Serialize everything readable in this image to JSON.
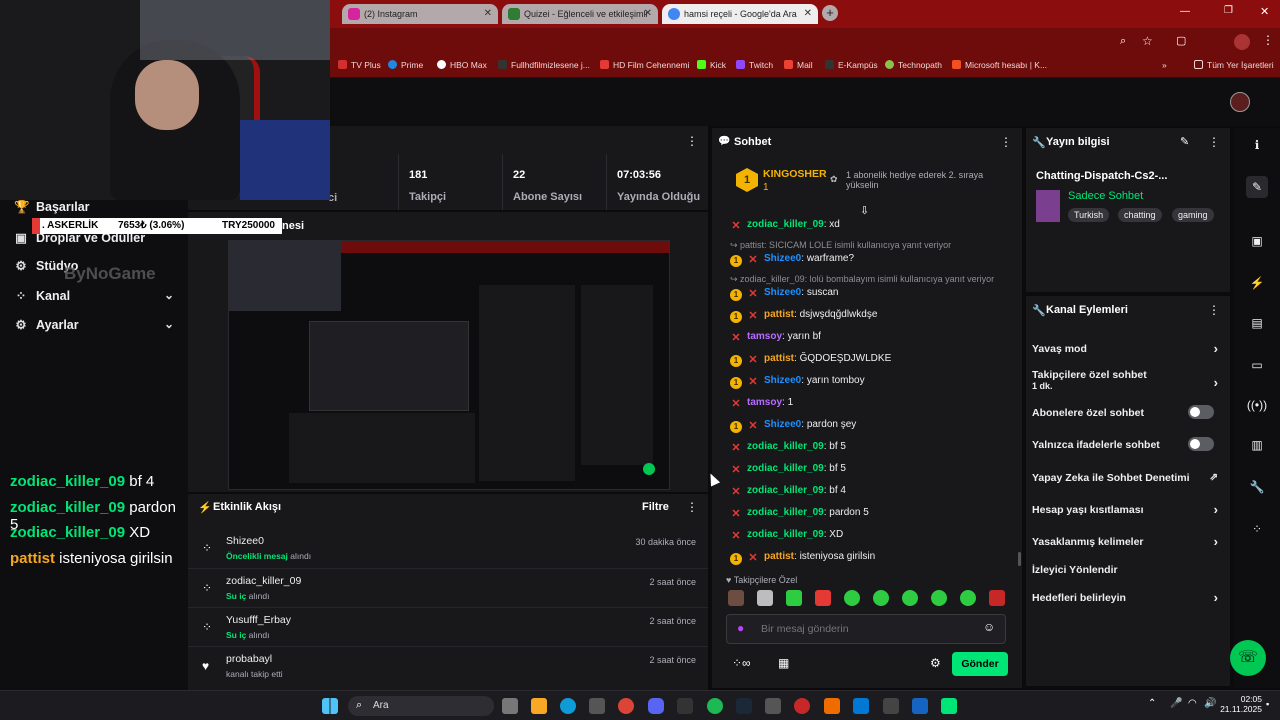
{
  "browser": {
    "tabs": [
      {
        "label": "(2) Instagram",
        "color": "#d6249f"
      },
      {
        "label": "Quizei - Eğlenceli ve etkileşimli",
        "color": "#2e7d32"
      },
      {
        "label": "hamsi reçeli - Google'da Ara",
        "color": "#4285f4"
      }
    ],
    "bookmarks": [
      {
        "label": "TV Plus",
        "color": "#d32f2f"
      },
      {
        "label": "Prime",
        "color": "#1e88e5"
      },
      {
        "label": "HBO Max",
        "color": "#ffffff"
      },
      {
        "label": "Fullhdfilmizlesene j...",
        "color": "#333333"
      },
      {
        "label": "HD Film Cehennemi",
        "color": "#e53935"
      },
      {
        "label": "Kick",
        "color": "#53fc18"
      },
      {
        "label": "Twitch",
        "color": "#9146ff"
      },
      {
        "label": "Mail",
        "color": "#ea4335"
      },
      {
        "label": "E-Kampüs",
        "color": "#333333"
      },
      {
        "label": "Technopath",
        "color": "#8bc34a"
      },
      {
        "label": "Microsoft hesabı | K...",
        "color": "#f25022"
      }
    ],
    "other_bookmarks": "Tüm Yer İşaretleri"
  },
  "ticker": {
    "label": ". ASKERLİK",
    "value": "7653₺ (3.06%)",
    "goal": "TRY250000"
  },
  "leftnav": {
    "items": [
      {
        "label": "Başarılar"
      },
      {
        "label": "Droplar ve Ödüller"
      },
      {
        "label": "Stüdyo"
      },
      {
        "label": "Kanal"
      },
      {
        "label": "Ayarlar"
      }
    ],
    "watermark": "ByNoGame"
  },
  "overlay_chat": [
    {
      "user": "zodiac_killer_09",
      "msg": "bf 4",
      "color": "#00e676"
    },
    {
      "user": "zodiac_killer_09",
      "msg": "pardon 5",
      "color": "#00e676"
    },
    {
      "user": "zodiac_killer_09",
      "msg": "XD",
      "color": "#00e676"
    },
    {
      "user": "pattist",
      "msg": "isteniyosa girilsin",
      "color": "#f5a623"
    }
  ],
  "stats": [
    {
      "value": "181",
      "label": "Takipçi"
    },
    {
      "value": "22",
      "label": "Abone Sayısı"
    },
    {
      "value": "07:03:56",
      "label": "Yayında Olduğu"
    }
  ],
  "stats_partial": "ci",
  "preview_title": "nesi",
  "activity": {
    "title": "Etkinlik Akışı",
    "filter": "Filtre",
    "items": [
      {
        "name": "Shizee0",
        "highlight": "Öncelikli mesaj",
        "rest": " alındı",
        "time": "30 dakika önce"
      },
      {
        "name": "zodiac_killer_09",
        "highlight": "Su iç",
        "rest": " alındı",
        "time": "2 saat önce"
      },
      {
        "name": "Yusufff_Erbay",
        "highlight": "Su iç",
        "rest": " alındı",
        "time": "2 saat önce"
      },
      {
        "name": "probabayl",
        "highlight": "",
        "rest": "kanalı takip etti",
        "time": "2 saat önce"
      }
    ]
  },
  "chat": {
    "title": "Sohbet",
    "pinned_user": "KINGOSHER",
    "pinned_count": "1",
    "pinned_text": "1 abonelik hediye ederek 2. sıraya yükselin",
    "messages": [
      {
        "type": "msg",
        "badge": "x",
        "user": "zodiac_killer_09",
        "color": "#00e676",
        "text": "xd"
      },
      {
        "type": "reply",
        "text": "pattist: SICICAM LOLE isimli kullanıcıya yanıt veriyor"
      },
      {
        "type": "msg",
        "badge": "o",
        "user": "Shizee0",
        "color": "#1e90ff",
        "text": "warframe?"
      },
      {
        "type": "reply",
        "text": "zodiac_killer_09: lolü bombalayım isimli kullanıcıya yanıt veriyor"
      },
      {
        "type": "msg",
        "badge": "o",
        "user": "Shizee0",
        "color": "#1e90ff",
        "text": "suscan"
      },
      {
        "type": "msg",
        "badge": "o",
        "user": "pattist",
        "color": "#f5a623",
        "text": "dsjwşdqğdlwkdşe"
      },
      {
        "type": "msg",
        "badge": "x",
        "user": "tamsoy",
        "color": "#b66dff",
        "text": "yarın bf"
      },
      {
        "type": "msg",
        "badge": "o",
        "user": "pattist",
        "color": "#f5a623",
        "text": "ĞQDOEŞDJWLDKE"
      },
      {
        "type": "msg",
        "badge": "o",
        "user": "Shizee0",
        "color": "#1e90ff",
        "text": "yarın tomboy"
      },
      {
        "type": "msg",
        "badge": "x",
        "user": "tamsoy",
        "color": "#b66dff",
        "text": "1"
      },
      {
        "type": "msg",
        "badge": "o",
        "user": "Shizee0",
        "color": "#1e90ff",
        "text": "pardon şey"
      },
      {
        "type": "msg",
        "badge": "x",
        "user": "zodiac_killer_09",
        "color": "#00e676",
        "text": "bf 5"
      },
      {
        "type": "msg",
        "badge": "x",
        "user": "zodiac_killer_09",
        "color": "#00e676",
        "text": "bf 5"
      },
      {
        "type": "msg",
        "badge": "x",
        "user": "zodiac_killer_09",
        "color": "#00e676",
        "text": "bf 4"
      },
      {
        "type": "msg",
        "badge": "x",
        "user": "zodiac_killer_09",
        "color": "#00e676",
        "text": "pardon 5"
      },
      {
        "type": "msg",
        "badge": "x",
        "user": "zodiac_killer_09",
        "color": "#00e676",
        "text": "XD"
      },
      {
        "type": "msg",
        "badge": "o",
        "user": "pattist",
        "color": "#f5a623",
        "text": "isteniyosa girilsin"
      }
    ],
    "emote_section": "Takipçilere Özel",
    "placeholder": "Bir mesaj gönderin",
    "send": "Gönder"
  },
  "stream_info": {
    "title": "Yayın bilgisi",
    "stream_title": "Chatting-Dispatch-Cs2-...",
    "category": "Sadece Sohbet",
    "tags": [
      "Turkish",
      "chatting",
      "gaming"
    ]
  },
  "channel_actions": {
    "title": "Kanal Eylemleri",
    "items": [
      {
        "label": "Yavaş mod",
        "control": "chevron"
      },
      {
        "label": "Takipçilere özel sohbet",
        "sub": "1 dk.",
        "control": "chevron"
      },
      {
        "label": "Abonelere özel sohbet",
        "control": "toggle"
      },
      {
        "label": "Yalnızca ifadelerle sohbet",
        "control": "toggle"
      },
      {
        "label": "Yapay Zeka ile Sohbet Denetimi",
        "control": "external"
      },
      {
        "label": "Hesap yaşı kısıtlaması",
        "control": "chevron"
      },
      {
        "label": "Yasaklanmış kelimeler",
        "control": "chevron"
      },
      {
        "label": "İzleyici Yönlendir",
        "control": "none"
      },
      {
        "label": "Hedefleri belirleyin",
        "control": "chevron"
      }
    ]
  },
  "taskbar": {
    "search": "Ara",
    "time": "02:05",
    "date": "21.11.2025"
  }
}
